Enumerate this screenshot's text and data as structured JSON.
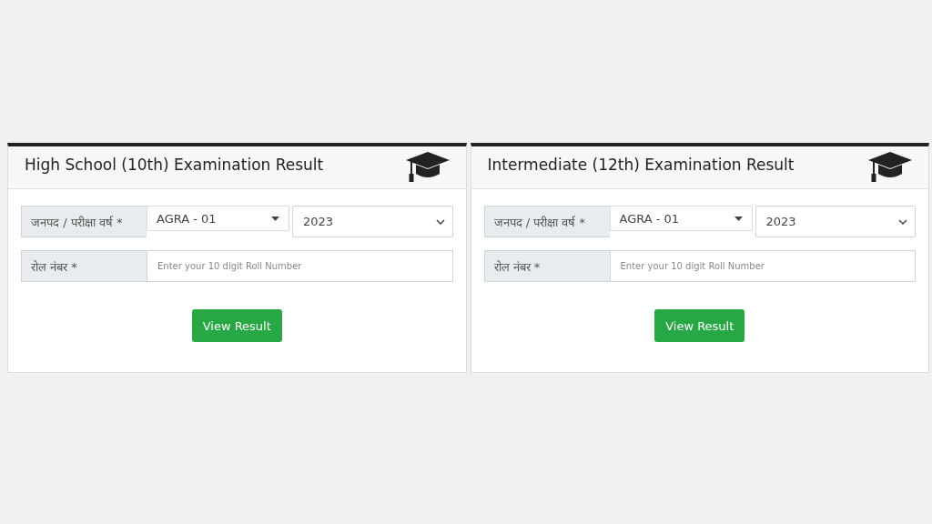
{
  "cards": [
    {
      "title": "High School (10th) Examination Result",
      "district_label": "जनपद / परीक्षा वर्ष *",
      "district": "AGRA - 01",
      "year": "2023",
      "roll_label": "रोल नंबर *",
      "roll_placeholder": "Enter your 10 digit Roll Number",
      "button": "View Result"
    },
    {
      "title": "Intermediate (12th) Examination Result",
      "district_label": "जनपद / परीक्षा वर्ष *",
      "district": "AGRA - 01",
      "year": "2023",
      "roll_label": "रोल नंबर *",
      "roll_placeholder": "Enter your 10 digit Roll Number",
      "button": "View Result"
    }
  ]
}
